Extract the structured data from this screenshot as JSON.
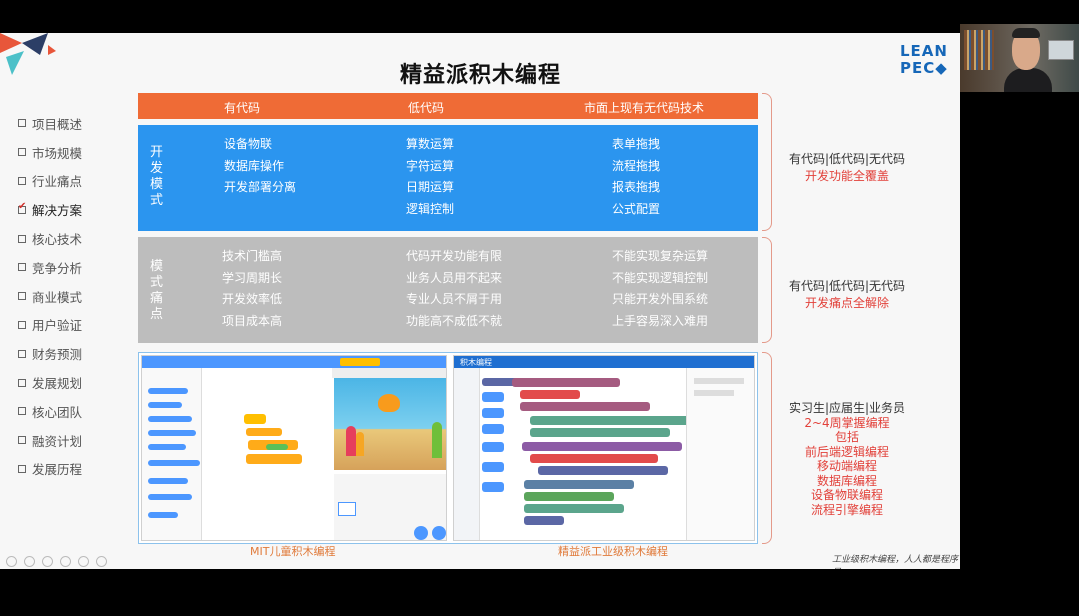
{
  "slide": {
    "title": "精益派积木编程",
    "brand_line1": "LEAN",
    "brand_line2": "PEC",
    "footer": "工业级积木编程，人人都是程序员"
  },
  "nav": {
    "items": [
      {
        "label": "项目概述",
        "active": false
      },
      {
        "label": "市场规模",
        "active": false
      },
      {
        "label": "行业痛点",
        "active": false
      },
      {
        "label": "解决方案",
        "active": true
      },
      {
        "label": "核心技术",
        "active": false
      },
      {
        "label": "竞争分析",
        "active": false
      },
      {
        "label": "商业模式",
        "active": false
      },
      {
        "label": "用户验证",
        "active": false
      },
      {
        "label": "财务预测",
        "active": false
      },
      {
        "label": "发展规划",
        "active": false
      },
      {
        "label": "核心团队",
        "active": false
      },
      {
        "label": "融资计划",
        "active": false
      },
      {
        "label": "发展历程",
        "active": false
      }
    ]
  },
  "header": {
    "col1": "有代码",
    "col2": "低代码",
    "col3": "市面上现有无代码技术"
  },
  "dev": {
    "label": "开发模式",
    "col1": [
      "设备物联",
      "数据库操作",
      "开发部署分离"
    ],
    "col2": [
      "算数运算",
      "字符运算",
      "日期运算",
      "逻辑控制"
    ],
    "col3": [
      "表单拖拽",
      "流程拖拽",
      "报表拖拽",
      "公式配置"
    ]
  },
  "pain": {
    "label": "模式痛点",
    "col1": [
      "技术门槛高",
      "学习周期长",
      "开发效率低",
      "项目成本高"
    ],
    "col2": [
      "代码开发功能有限",
      "业务人员用不起来",
      "专业人员不屑于用",
      "功能高不成低不就"
    ],
    "col3": [
      "不能实现复杂运算",
      "不能实现逻辑控制",
      "只能开发外围系统",
      "上手容易深入难用"
    ]
  },
  "notes": {
    "n1_dark": "有代码|低代码|无代码",
    "n1_red": "开发功能全覆盖",
    "n2_dark": "有代码|低代码|无代码",
    "n2_red": "开发痛点全解除",
    "n3_dark": "实习生|应届生|业务员",
    "n3_red": [
      "2~4周掌握编程",
      "包括",
      "前后端逻辑编程",
      "移动端编程",
      "数据库编程",
      "设备物联编程",
      "流程引擎编程"
    ]
  },
  "shots": {
    "left_caption": "MIT儿童积木编程",
    "right_caption": "精益派工业级积木编程",
    "right_app_title": "积木编程"
  },
  "colors": {
    "orange": "#ef6b36",
    "blue": "#2b95ef",
    "gray": "#bdbdbd",
    "red_text": "#e2413a"
  }
}
